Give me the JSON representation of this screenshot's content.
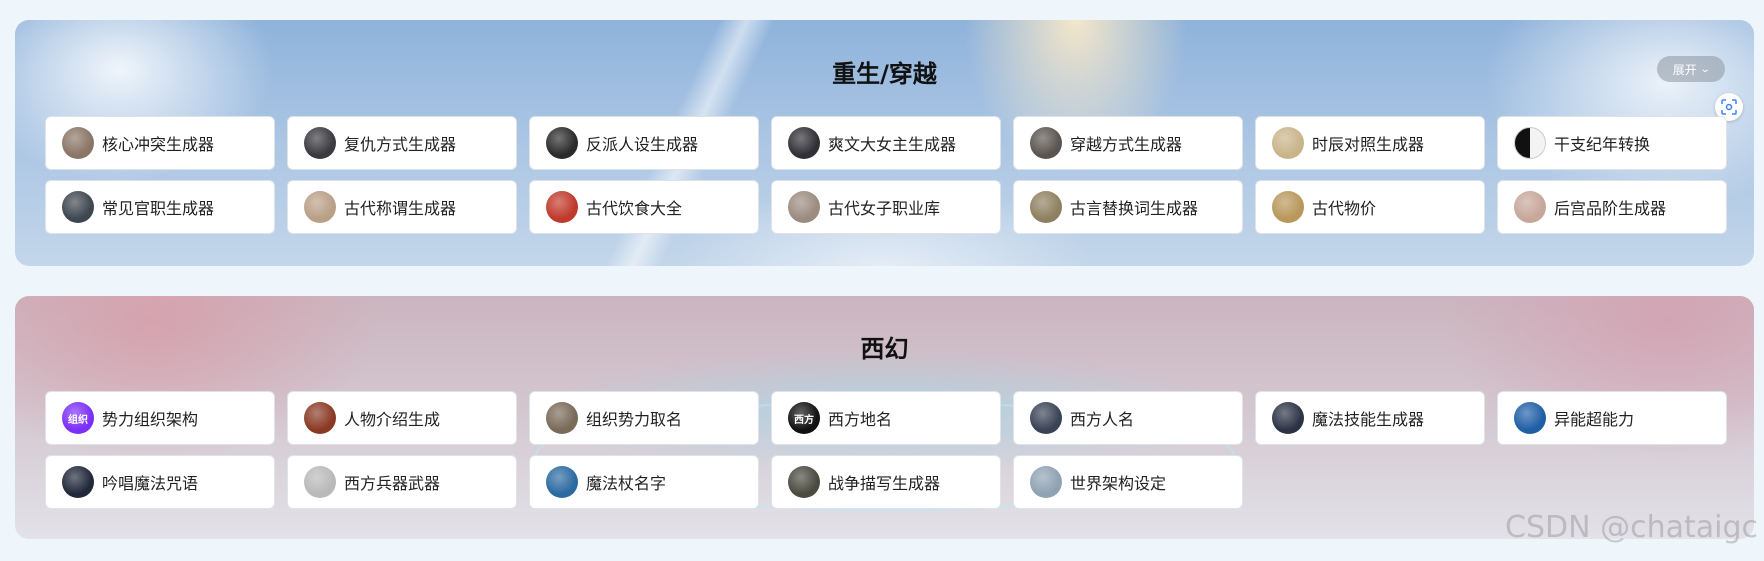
{
  "sections": [
    {
      "title": "重生/穿越",
      "expand_label": "展开",
      "items": [
        {
          "label": "核心冲突生成器",
          "icon": "portrait-icon",
          "color": "#8a7566"
        },
        {
          "label": "复仇方式生成器",
          "icon": "portrait-icon",
          "color": "#3b3a3f"
        },
        {
          "label": "反派人设生成器",
          "icon": "portrait-icon",
          "color": "#2b2b2b"
        },
        {
          "label": "爽文大女主生成器",
          "icon": "portrait-icon",
          "color": "#303036"
        },
        {
          "label": "穿越方式生成器",
          "icon": "portrait-icon",
          "color": "#5a5550"
        },
        {
          "label": "时辰对照生成器",
          "icon": "sundial-icon",
          "color": "#c9b48a"
        },
        {
          "label": "干支纪年转换",
          "icon": "yin-yang-icon",
          "color": "#e8e8e8"
        },
        {
          "label": "常见官职生成器",
          "icon": "portrait-icon",
          "color": "#3e4650"
        },
        {
          "label": "古代称谓生成器",
          "icon": "portrait-icon",
          "color": "#b99f86"
        },
        {
          "label": "古代饮食大全",
          "icon": "food-icon",
          "color": "#c0392b"
        },
        {
          "label": "古代女子职业库",
          "icon": "portrait-icon",
          "color": "#9b8b80"
        },
        {
          "label": "古言替换词生成器",
          "icon": "scroll-icon",
          "color": "#8e8060"
        },
        {
          "label": "古代物价",
          "icon": "coin-icon",
          "color": "#b8975a"
        },
        {
          "label": "后宫品阶生成器",
          "icon": "portrait-icon",
          "color": "#c6a79a"
        }
      ]
    },
    {
      "title": "西幻",
      "items": [
        {
          "label": "势力组织架构",
          "icon": "org-badge-icon",
          "color": "#7b2ff7",
          "badge": "组织"
        },
        {
          "label": "人物介绍生成",
          "icon": "portrait-icon",
          "color": "#8a3a24"
        },
        {
          "label": "组织势力取名",
          "icon": "castle-icon",
          "color": "#7a6a58"
        },
        {
          "label": "西方地名",
          "icon": "place-badge-icon",
          "color": "#111111",
          "badge": "西方"
        },
        {
          "label": "西方人名",
          "icon": "portrait-icon",
          "color": "#3a4356"
        },
        {
          "label": "魔法技能生成器",
          "icon": "magic-icon",
          "color": "#2c3345"
        },
        {
          "label": "异能超能力",
          "icon": "energy-icon",
          "color": "#1f5fa6"
        },
        {
          "label": "吟唱魔法咒语",
          "icon": "spell-icon",
          "color": "#20283a"
        },
        {
          "label": "西方兵器武器",
          "icon": "crossed-swords-icon",
          "color": "#b9b9b9"
        },
        {
          "label": "魔法杖名字",
          "icon": "wand-icon",
          "color": "#2b6aa0"
        },
        {
          "label": "战争描写生成器",
          "icon": "battle-icon",
          "color": "#4a4a40"
        },
        {
          "label": "世界架构设定",
          "icon": "world-icon",
          "color": "#8fa2b3"
        }
      ]
    }
  ],
  "watermark": "CSDN @chataigc"
}
